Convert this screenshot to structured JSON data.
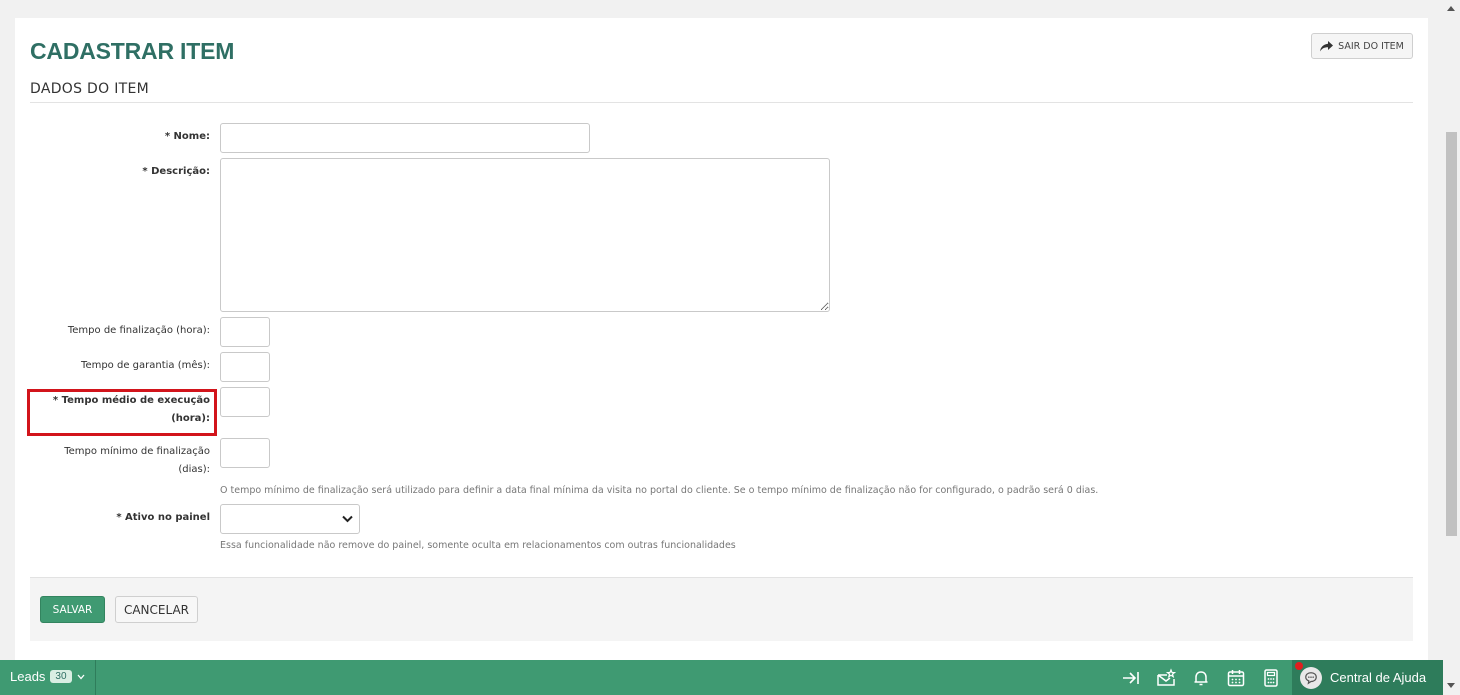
{
  "page": {
    "title": "CADASTRAR ITEM",
    "section": "DADOS DO ITEM"
  },
  "header": {
    "exit_label": "SAIR DO ITEM",
    "exit_icon": "share-arrow-icon"
  },
  "form": {
    "nome": {
      "label": "* Nome:",
      "value": ""
    },
    "descricao": {
      "label": "* Descrição:",
      "value": ""
    },
    "tempo_finalizacao": {
      "label": "Tempo de finalização (hora):",
      "value": ""
    },
    "tempo_garantia": {
      "label": "Tempo de garantia (mês):",
      "value": ""
    },
    "tempo_medio": {
      "label_line1": "* Tempo médio de execução",
      "label_line2": "(hora):",
      "value": ""
    },
    "tempo_minimo": {
      "label_line1": "Tempo mínimo de finalização",
      "label_line2": "(dias):",
      "value": "",
      "help": "O tempo mínimo de finalização será utilizado para definir a data final mínima da visita no portal do cliente. Se o tempo mínimo de finalização não for configurado, o padrão será 0 dias."
    },
    "ativo": {
      "label": "* Ativo no painel",
      "selected": "",
      "help": "Essa funcionalidade não remove do painel, somente oculta em relacionamentos com outras funcionalidades"
    }
  },
  "actions": {
    "save": "SALVAR",
    "cancel": "CANCELAR"
  },
  "colors": {
    "brand_green": "#3f9a72",
    "title_green": "#2f6f64",
    "highlight_red": "#d2141b"
  },
  "bottombar": {
    "leads_label": "Leads",
    "leads_count": "30",
    "icons": [
      "collapse-arrow-icon",
      "mail-star-icon",
      "bell-icon",
      "calendar-icon",
      "calculator-icon"
    ],
    "help_label": "Central de Ajuda"
  }
}
